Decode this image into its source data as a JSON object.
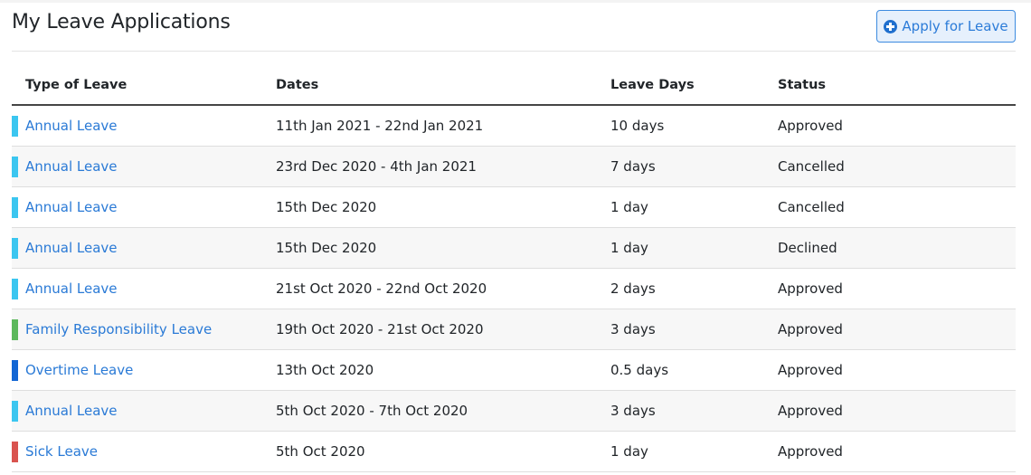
{
  "page": {
    "title": "My Leave Applications",
    "apply_button": {
      "label": "Apply for Leave",
      "icon": "plus-circle-icon"
    }
  },
  "colors": {
    "annual": "#3bc6f0",
    "family": "#5cb85c",
    "overtime": "#1266d4",
    "sick": "#d9534f",
    "link": "#2a7ad6"
  },
  "table": {
    "headers": [
      "Type of Leave",
      "Dates",
      "Leave Days",
      "Status"
    ],
    "rows": [
      {
        "type": "Annual Leave",
        "category": "annual",
        "dates": "11th Jan 2021 - 22nd Jan 2021",
        "days": "10 days",
        "status": "Approved"
      },
      {
        "type": "Annual Leave",
        "category": "annual",
        "dates": "23rd Dec 2020 - 4th Jan 2021",
        "days": "7 days",
        "status": "Cancelled"
      },
      {
        "type": "Annual Leave",
        "category": "annual",
        "dates": "15th Dec 2020",
        "days": "1 day",
        "status": "Cancelled"
      },
      {
        "type": "Annual Leave",
        "category": "annual",
        "dates": "15th Dec 2020",
        "days": "1 day",
        "status": "Declined"
      },
      {
        "type": "Annual Leave",
        "category": "annual",
        "dates": "21st Oct 2020 - 22nd Oct 2020",
        "days": "2 days",
        "status": "Approved"
      },
      {
        "type": "Family Responsibility Leave",
        "category": "family",
        "dates": "19th Oct 2020 - 21st Oct 2020",
        "days": "3 days",
        "status": "Approved"
      },
      {
        "type": "Overtime Leave",
        "category": "overtime",
        "dates": "13th Oct 2020",
        "days": "0.5 days",
        "status": "Approved"
      },
      {
        "type": "Annual Leave",
        "category": "annual",
        "dates": "5th Oct 2020 - 7th Oct 2020",
        "days": "3 days",
        "status": "Approved"
      },
      {
        "type": "Sick Leave",
        "category": "sick",
        "dates": "5th Oct 2020",
        "days": "1 day",
        "status": "Approved"
      }
    ]
  }
}
